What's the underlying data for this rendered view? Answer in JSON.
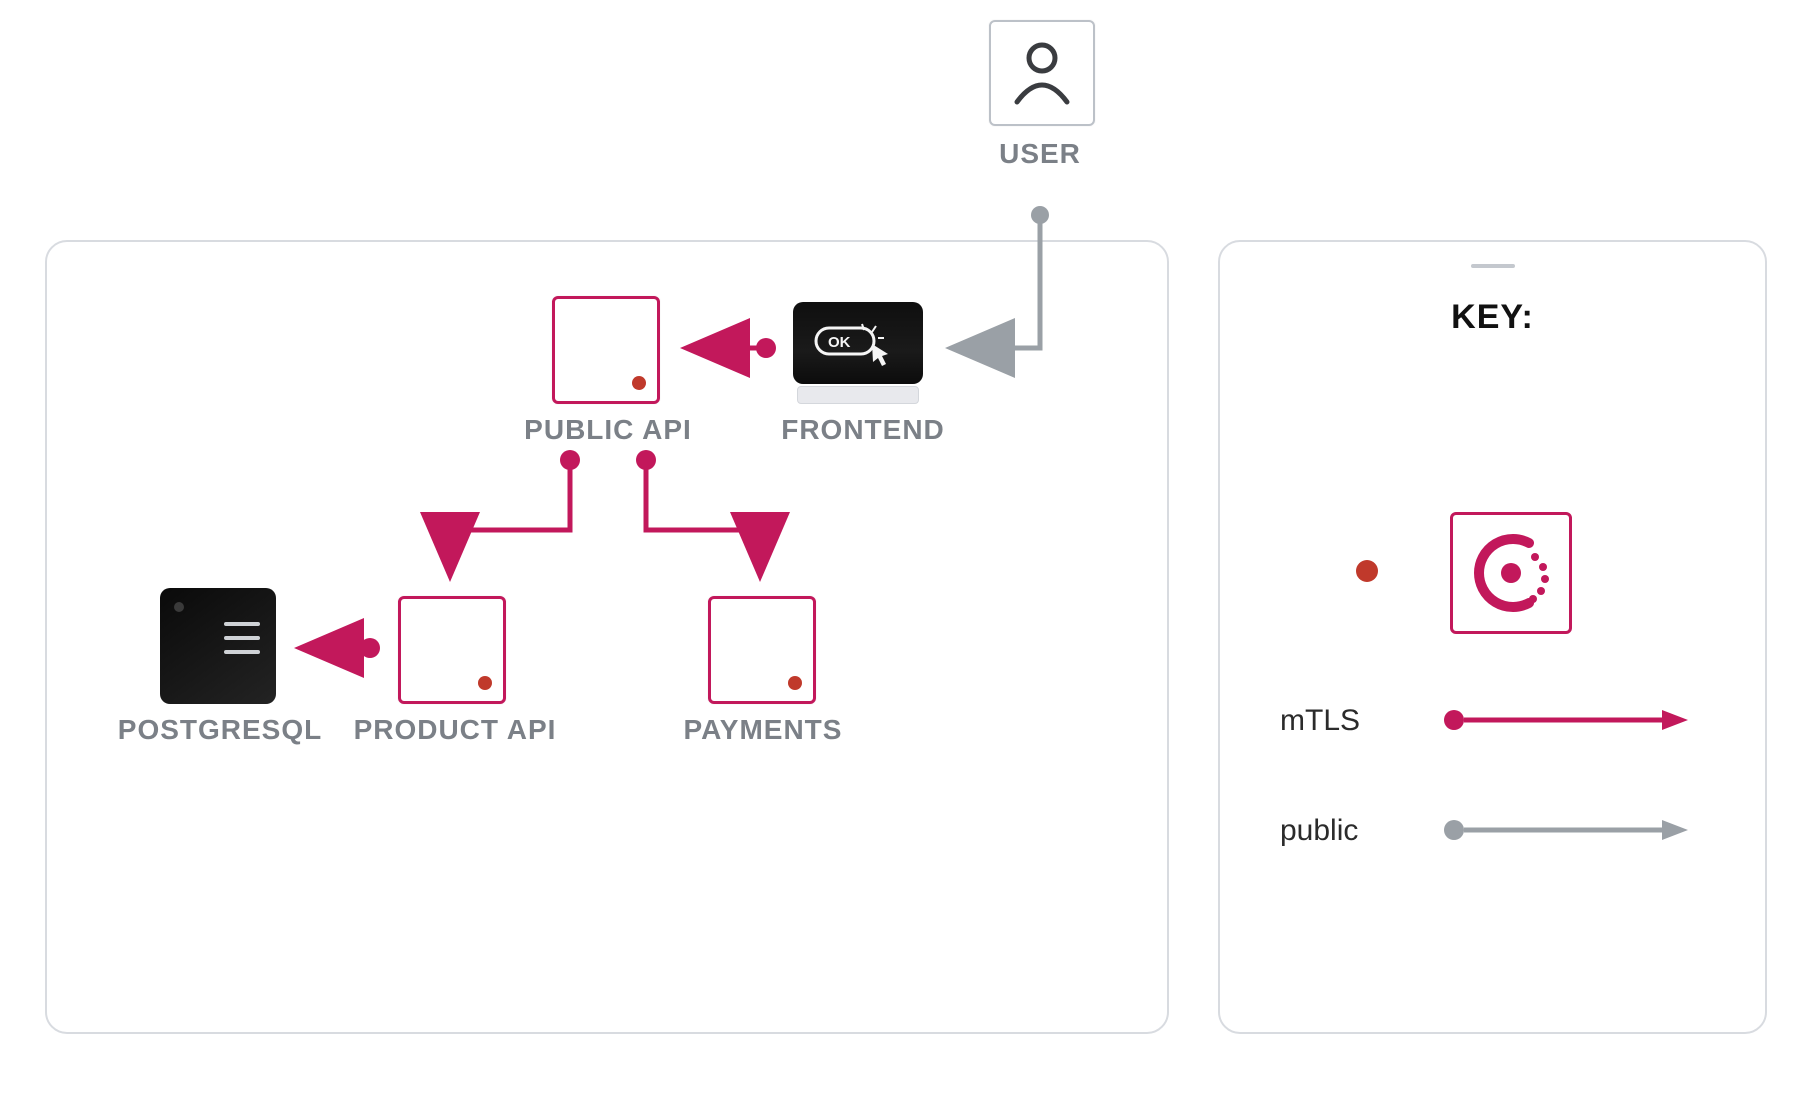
{
  "nodes": {
    "user": {
      "label": "USER"
    },
    "frontend": {
      "label": "FRONTEND",
      "screen_text": "OK"
    },
    "public_api": {
      "label": "PUBLIC API"
    },
    "product_api": {
      "label": "PRODUCT API"
    },
    "payments": {
      "label": "PAYMENTS"
    },
    "postgres": {
      "label": "POSTGRESQL"
    }
  },
  "key": {
    "title": "KEY:",
    "mtls_label": "mTLS",
    "public_label": "public"
  },
  "edges": [
    {
      "from": "user",
      "to": "frontend",
      "type": "public"
    },
    {
      "from": "frontend",
      "to": "public_api",
      "type": "mtls"
    },
    {
      "from": "public_api",
      "to": "product_api",
      "type": "mtls"
    },
    {
      "from": "public_api",
      "to": "payments",
      "type": "mtls"
    },
    {
      "from": "product_api",
      "to": "postgres",
      "type": "mtls"
    }
  ],
  "colors": {
    "mtls": "#c2185b",
    "public": "#9aa0a6",
    "sidecar_dot": "#c0392b"
  }
}
